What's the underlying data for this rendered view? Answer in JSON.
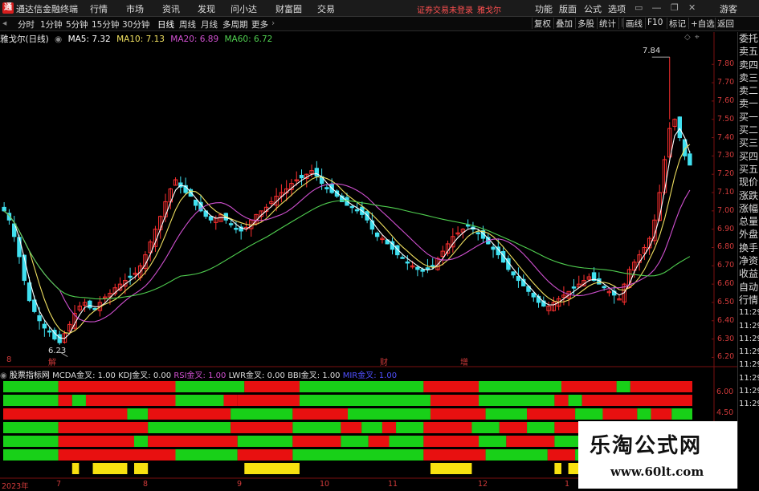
{
  "app": {
    "title": "通达信金融终端",
    "logo_icon": "tdx-logo-icon"
  },
  "menu": [
    "行情",
    "市场",
    "资讯",
    "发现",
    "问小达",
    "财富圈",
    "交易"
  ],
  "warning": "证券交易未登录",
  "stock_label": "雅戈尔",
  "top_right": [
    "功能",
    "版面",
    "公式",
    "选项"
  ],
  "guest": "游客",
  "periods": [
    "分时",
    "1分钟",
    "5分钟",
    "15分钟",
    "30分钟",
    "日线",
    "周线",
    "月线",
    "多周期",
    "更多"
  ],
  "toolbar_right": [
    "复权",
    "叠加",
    "多股",
    "统计",
    "画线",
    "F10",
    "标记",
    "+自选",
    "返回"
  ],
  "chart_title": "雅戈尔(日线)",
  "ma": [
    {
      "label": "MA5: 7.32",
      "color": "#ffffff"
    },
    {
      "label": "MA10: 7.13",
      "color": "#f0e060"
    },
    {
      "label": "MA20: 6.89",
      "color": "#d050d0"
    },
    {
      "label": "MA60: 6.72",
      "color": "#50d050"
    }
  ],
  "right_nav": [
    "委托",
    "卖五",
    "卖四",
    "卖三",
    "卖二",
    "卖一",
    "买一",
    "买二",
    "买三",
    "买四",
    "买五",
    "现价",
    "涨跌",
    "涨幅",
    "总量",
    "外盘",
    "换手",
    "净资",
    "收益",
    "自动",
    "行情",
    "11:29",
    "11:29",
    "11:29",
    "11:29",
    "11:29",
    "11:29",
    "11:29",
    "11:29"
  ],
  "sub_indicator": {
    "name": "股票指标网",
    "items": [
      {
        "label": "MCDA金叉: 1.00",
        "color": "#dddddd"
      },
      {
        "label": "KDJ金叉: 0.00",
        "color": "#dddddd"
      },
      {
        "label": "RSI金叉: 1.00",
        "color": "#d050d0"
      },
      {
        "label": "LWR金叉: 0.00",
        "color": "#dddddd"
      },
      {
        "label": "BBI金叉: 1.00",
        "color": "#dddddd"
      },
      {
        "label": "MIR金叉: 1.00",
        "color": "#5050ff"
      }
    ]
  },
  "sub_y": [
    "6.00",
    "4.50"
  ],
  "price_markers": {
    "high": "7.84",
    "low": "6.23"
  },
  "event_markers": [
    "8",
    "解",
    "财",
    "增"
  ],
  "x_labels": [
    "2023年",
    "7",
    "8",
    "9",
    "10",
    "11",
    "12",
    "1"
  ],
  "watermark": {
    "title": "乐淘公式网",
    "url": "www.60lt.com"
  },
  "chart_data": {
    "type": "candlestick",
    "y_ticks": [
      7.8,
      7.7,
      7.6,
      7.5,
      7.4,
      7.3,
      7.2,
      7.1,
      7.0,
      6.9,
      6.8,
      6.7,
      6.6,
      6.5,
      6.4,
      6.3,
      6.2
    ],
    "ylim": [
      6.18,
      7.88
    ],
    "high_mark": 7.84,
    "low_mark": 6.23,
    "colors": {
      "up": "#ff3030",
      "down": "#40e0f0",
      "ma5": "#ffffff",
      "ma10": "#f0e060",
      "ma20": "#d050d0",
      "ma60": "#50d050",
      "green": "#18d018",
      "red": "#e81010",
      "yellow": "#f8e010"
    },
    "closes": [
      7.0,
      6.95,
      6.86,
      6.75,
      6.62,
      6.51,
      6.45,
      6.4,
      6.36,
      6.34,
      6.3,
      6.28,
      6.33,
      6.38,
      6.44,
      6.48,
      6.5,
      6.47,
      6.46,
      6.5,
      6.53,
      6.55,
      6.58,
      6.6,
      6.62,
      6.64,
      6.66,
      6.7,
      6.76,
      6.83,
      6.9,
      6.97,
      7.05,
      7.12,
      7.17,
      7.13,
      7.1,
      7.08,
      7.03,
      7.0,
      6.97,
      6.95,
      6.96,
      6.98,
      6.95,
      6.93,
      6.9,
      6.89,
      6.91,
      6.95,
      6.98,
      7.0,
      7.02,
      7.05,
      7.08,
      7.1,
      7.12,
      7.15,
      7.17,
      7.18,
      7.2,
      7.22,
      7.19,
      7.15,
      7.12,
      7.1,
      7.08,
      7.05,
      7.03,
      7.02,
      7.0,
      6.98,
      6.95,
      6.9,
      6.86,
      6.85,
      6.82,
      6.79,
      6.76,
      6.74,
      6.72,
      6.7,
      6.68,
      6.67,
      6.68,
      6.7,
      6.74,
      6.78,
      6.82,
      6.86,
      6.88,
      6.9,
      6.92,
      6.9,
      6.88,
      6.85,
      6.82,
      6.79,
      6.76,
      6.72,
      6.68,
      6.65,
      6.62,
      6.59,
      6.56,
      6.53,
      6.5,
      6.48,
      6.48,
      6.5,
      6.52,
      6.54,
      6.56,
      6.58,
      6.6,
      6.62,
      6.64,
      6.62,
      6.6,
      6.58,
      6.56,
      6.54,
      6.52,
      6.6,
      6.68,
      6.72,
      6.76,
      6.8,
      6.85,
      6.95,
      7.1,
      7.28,
      7.45,
      7.5,
      7.4,
      7.3,
      7.25
    ],
    "strips": [
      {
        "segments": [
          [
            0,
            0.08,
            "g"
          ],
          [
            0.08,
            0.25,
            "r"
          ],
          [
            0.25,
            0.35,
            "g"
          ],
          [
            0.35,
            0.43,
            "r"
          ],
          [
            0.43,
            0.61,
            "g"
          ],
          [
            0.61,
            0.69,
            "r"
          ],
          [
            0.69,
            0.81,
            "g"
          ],
          [
            0.81,
            0.89,
            "r"
          ],
          [
            0.89,
            0.91,
            "g"
          ],
          [
            0.91,
            1.0,
            "r"
          ]
        ]
      },
      {
        "segments": [
          [
            0,
            0.08,
            "g"
          ],
          [
            0.08,
            0.1,
            "r"
          ],
          [
            0.1,
            0.12,
            "g"
          ],
          [
            0.12,
            0.25,
            "r"
          ],
          [
            0.25,
            0.32,
            "g"
          ],
          [
            0.32,
            0.34,
            "r"
          ],
          [
            0.34,
            0.43,
            "r"
          ],
          [
            0.43,
            0.62,
            "g"
          ],
          [
            0.62,
            0.69,
            "r"
          ],
          [
            0.69,
            0.8,
            "g"
          ],
          [
            0.8,
            0.82,
            "r"
          ],
          [
            0.82,
            0.84,
            "g"
          ],
          [
            0.84,
            1.0,
            "r"
          ]
        ]
      },
      {
        "segments": [
          [
            0,
            0.18,
            "r"
          ],
          [
            0.18,
            0.21,
            "g"
          ],
          [
            0.21,
            0.33,
            "r"
          ],
          [
            0.33,
            0.42,
            "g"
          ],
          [
            0.42,
            0.5,
            "r"
          ],
          [
            0.5,
            0.62,
            "g"
          ],
          [
            0.62,
            0.7,
            "r"
          ],
          [
            0.7,
            0.76,
            "g"
          ],
          [
            0.76,
            0.83,
            "r"
          ],
          [
            0.83,
            0.87,
            "g"
          ],
          [
            0.87,
            0.92,
            "r"
          ],
          [
            0.92,
            0.94,
            "g"
          ],
          [
            0.94,
            0.97,
            "r"
          ],
          [
            0.97,
            1.0,
            "g"
          ]
        ]
      },
      {
        "segments": [
          [
            0,
            0.08,
            "g"
          ],
          [
            0.08,
            0.21,
            "r"
          ],
          [
            0.21,
            0.33,
            "g"
          ],
          [
            0.33,
            0.42,
            "r"
          ],
          [
            0.42,
            0.49,
            "g"
          ],
          [
            0.49,
            0.52,
            "r"
          ],
          [
            0.52,
            0.55,
            "g"
          ],
          [
            0.55,
            0.57,
            "r"
          ],
          [
            0.57,
            0.61,
            "g"
          ],
          [
            0.61,
            0.68,
            "r"
          ],
          [
            0.68,
            0.72,
            "g"
          ],
          [
            0.72,
            0.76,
            "r"
          ],
          [
            0.76,
            0.8,
            "g"
          ],
          [
            0.8,
            0.84,
            "r"
          ],
          [
            0.84,
            1.0,
            "g"
          ]
        ]
      },
      {
        "segments": [
          [
            0,
            0.08,
            "g"
          ],
          [
            0.08,
            0.19,
            "r"
          ],
          [
            0.19,
            0.21,
            "g"
          ],
          [
            0.21,
            0.34,
            "r"
          ],
          [
            0.34,
            0.42,
            "g"
          ],
          [
            0.42,
            0.49,
            "r"
          ],
          [
            0.49,
            0.53,
            "g"
          ],
          [
            0.53,
            0.56,
            "r"
          ],
          [
            0.56,
            0.61,
            "g"
          ],
          [
            0.61,
            0.69,
            "r"
          ],
          [
            0.69,
            0.73,
            "g"
          ],
          [
            0.73,
            0.8,
            "r"
          ],
          [
            0.8,
            1.0,
            "g"
          ]
        ]
      },
      {
        "segments": [
          [
            0,
            0.08,
            "g"
          ],
          [
            0.08,
            0.25,
            "r"
          ],
          [
            0.25,
            0.34,
            "g"
          ],
          [
            0.34,
            0.42,
            "r"
          ],
          [
            0.42,
            0.61,
            "g"
          ],
          [
            0.61,
            0.7,
            "r"
          ],
          [
            0.7,
            0.79,
            "g"
          ],
          [
            0.79,
            0.83,
            "r"
          ],
          [
            0.83,
            1.0,
            "g"
          ]
        ]
      }
    ],
    "yellow_segments": [
      [
        0.1,
        0.11
      ],
      [
        0.13,
        0.18
      ],
      [
        0.19,
        0.21
      ],
      [
        0.35,
        0.43
      ],
      [
        0.62,
        0.68
      ],
      [
        0.8,
        0.81
      ],
      [
        0.82,
        0.84
      ]
    ]
  }
}
